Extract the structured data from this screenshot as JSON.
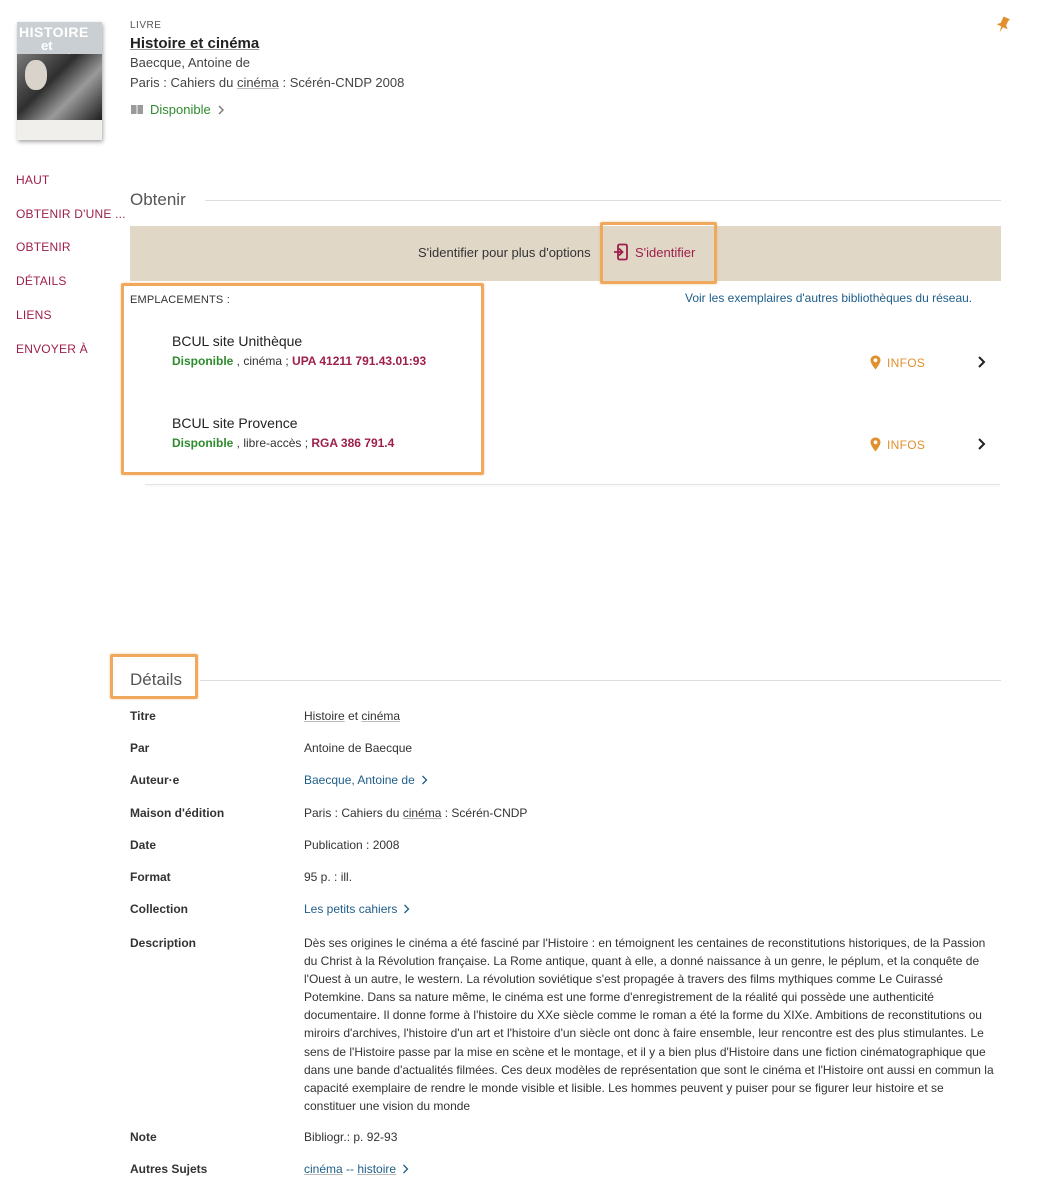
{
  "record": {
    "type_label": "LIVRE",
    "title": "Histoire et cinéma",
    "author": "Baecque, Antoine de",
    "publication_parts": [
      "Paris : Cahiers du ",
      "cinéma",
      " : Scérén-CNDP 2008"
    ],
    "availability": "Disponible",
    "cover": {
      "title_line1": "HISTOIRE",
      "title_line2": "et CINÉMA"
    }
  },
  "nav": {
    "items": [
      "HAUT",
      "OBTENIR D'UNE ...",
      "OBTENIR",
      "DÉTAILS",
      "LIENS",
      "ENVOYER À"
    ]
  },
  "obtain": {
    "section_title": "Obtenir",
    "login_prompt": "S'identifier pour plus d'options",
    "login_button": "S'identifier",
    "locations_label": "EMPLACEMENTS :",
    "other_libraries_link": "Voir les exemplaires d'autres bibliothèques du réseau.",
    "locations": [
      {
        "name": "BCUL site Unithèque",
        "status": "Disponible",
        "collection": " , cinéma ; ",
        "call_number": "UPA 41211 791.43.01:93",
        "infos_label": "INFOS"
      },
      {
        "name": "BCUL site Provence",
        "status": "Disponible",
        "collection": " , libre-accès ; ",
        "call_number": "RGA 386 791.4",
        "infos_label": "INFOS"
      }
    ]
  },
  "details": {
    "section_title": "Détails",
    "labels": {
      "title": "Titre",
      "by": "Par",
      "author": "Auteur·e",
      "publisher": "Maison d'édition",
      "date": "Date",
      "format": "Format",
      "collection": "Collection",
      "description": "Description",
      "note": "Note",
      "subjects": "Autres Sujets"
    },
    "values": {
      "title_part1": "Histoire",
      "title_mid": " et ",
      "title_part2": "cinéma",
      "by": "Antoine de Baecque",
      "author": "Baecque, Antoine de",
      "publisher_part1": "Paris : Cahiers du ",
      "publisher_part2": "cinéma",
      "publisher_part3": " : Scérén-CNDP",
      "date": "Publication : 2008",
      "format": "95 p. : ill.",
      "collection": "Les petits cahiers",
      "description": "Dès ses origines le cinéma a été fasciné par l'Histoire : en témoignent les centaines de reconstitutions historiques, de la Passion du Christ à la Révolution française. La Rome antique, quant à elle, a donné naissance à un genre, le péplum, et la conquête de l'Ouest à un autre, le western. La révolution soviétique s'est propagée à travers des films mythiques comme Le Cuirassé Potemkine. Dans sa nature même, le cinéma est une forme d'enregistrement de la réalité qui possède une authenticité documentaire. Il donne forme à l'histoire du XXe siècle comme le roman a été la forme du XIXe. Ambitions de reconstitutions ou miroirs d'archives, l'histoire d'un art et l'histoire d'un siècle ont donc à faire ensemble, leur rencontre est des plus stimulantes. Le sens de l'Histoire passe par la mise en scène et le montage, et il y a bien plus d'Histoire dans une fiction cinématographique que dans une bande d'actualités filmées. Ces deux modèles de représentation que sont le cinéma et l'Histoire ont aussi en commun la capacité exemplaire de rendre le monde visible et lisible. Les hommes peuvent y puiser pour se figurer leur histoire et se constituer une vision du monde",
      "note": "Bibliogr.: p. 92-93",
      "subject_part1": "cinéma",
      "subject_sep": " -- ",
      "subject_part2": "histoire"
    }
  },
  "colors": {
    "accent": "#9e1f4a",
    "available": "#2e8b2e",
    "link": "#1f5e8a",
    "login_bar": "#e0d7c7",
    "highlight": "#f0a95c",
    "infos": "#e0902f"
  }
}
